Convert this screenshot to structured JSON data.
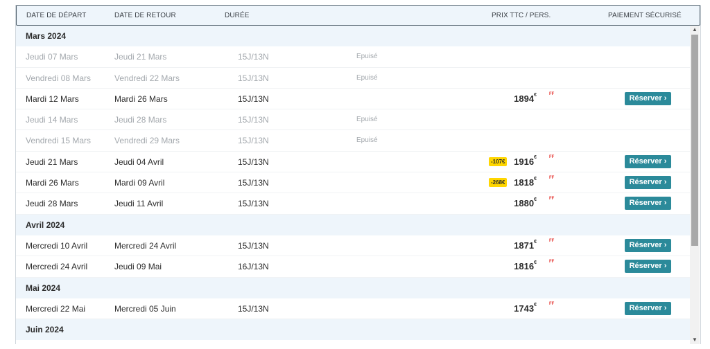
{
  "header": {
    "depart": "DATE DE DÉPART",
    "retour": "DATE DE RETOUR",
    "duree": "DURÉE",
    "prix": "PRIX TTC / PERS.",
    "paiement": "PAIEMENT SÉCURISÉ"
  },
  "currency": "€",
  "ff_label": "FF",
  "button_label": "Réserver",
  "status_sold_out": "Epuisé",
  "colors": {
    "accent": "#2b8a9a",
    "promo": "#ffd600",
    "month_bg": "#eef5fb",
    "dim_text": "#a3a8ad"
  },
  "rows": [
    {
      "type": "month",
      "label": "Mars 2024"
    },
    {
      "type": "trip",
      "depart": "Jeudi 07 Mars",
      "retour": "Jeudi 21 Mars",
      "duree": "15J/13N",
      "status": "Epuisé"
    },
    {
      "type": "trip",
      "depart": "Vendredi 08 Mars",
      "retour": "Vendredi 22 Mars",
      "duree": "15J/13N",
      "status": "Epuisé"
    },
    {
      "type": "trip",
      "depart": "Mardi 12 Mars",
      "retour": "Mardi 26 Mars",
      "duree": "15J/13N",
      "price": "1894"
    },
    {
      "type": "trip",
      "depart": "Jeudi 14 Mars",
      "retour": "Jeudi 28 Mars",
      "duree": "15J/13N",
      "status": "Epuisé"
    },
    {
      "type": "trip",
      "depart": "Vendredi 15 Mars",
      "retour": "Vendredi 29 Mars",
      "duree": "15J/13N",
      "status": "Epuisé"
    },
    {
      "type": "trip",
      "depart": "Jeudi 21 Mars",
      "retour": "Jeudi 04 Avril",
      "duree": "15J/13N",
      "price": "1916",
      "promo": "-107€"
    },
    {
      "type": "trip",
      "depart": "Mardi 26 Mars",
      "retour": "Mardi 09 Avril",
      "duree": "15J/13N",
      "price": "1818",
      "promo": "-268€"
    },
    {
      "type": "trip",
      "depart": "Jeudi 28 Mars",
      "retour": "Jeudi 11 Avril",
      "duree": "15J/13N",
      "price": "1880"
    },
    {
      "type": "month",
      "label": "Avril 2024"
    },
    {
      "type": "trip",
      "depart": "Mercredi 10 Avril",
      "retour": "Mercredi 24 Avril",
      "duree": "15J/13N",
      "price": "1871"
    },
    {
      "type": "trip",
      "depart": "Mercredi 24 Avril",
      "retour": "Jeudi 09 Mai",
      "duree": "16J/13N",
      "price": "1816"
    },
    {
      "type": "month",
      "label": "Mai 2024"
    },
    {
      "type": "trip",
      "depart": "Mercredi 22 Mai",
      "retour": "Mercredi 05 Juin",
      "duree": "15J/13N",
      "price": "1743"
    },
    {
      "type": "month",
      "label": "Juin 2024"
    }
  ]
}
